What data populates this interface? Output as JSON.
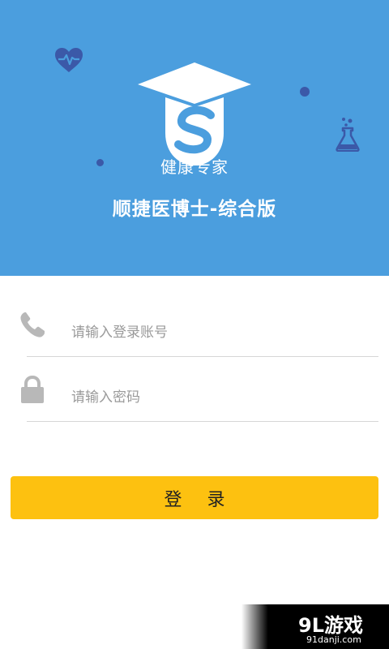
{
  "header": {
    "slogan": "健康专家",
    "app_name": "顺捷医博士-综合版"
  },
  "form": {
    "account_placeholder": "请输入登录账号",
    "account_value": "",
    "password_placeholder": "请输入密码",
    "password_value": "",
    "login_label": "登 录"
  },
  "icons": {
    "account": "phone-icon",
    "password": "lock-icon",
    "decor": [
      "heart-pulse-icon",
      "flask-icon"
    ]
  },
  "watermark": {
    "logo": "9L游戏",
    "url": "91danji.com"
  },
  "colors": {
    "header_bg": "#4b9ede",
    "accent_dots": "#3b59a8",
    "login_button": "#fdc110",
    "divider": "#d6d6d6",
    "icon_gray": "#b8b8b8"
  }
}
